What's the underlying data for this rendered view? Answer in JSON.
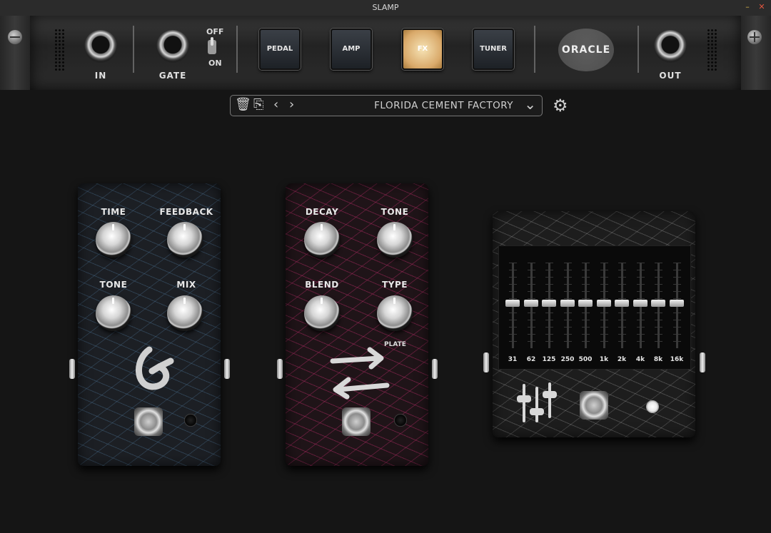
{
  "window": {
    "title": "SLAMP",
    "minimize_glyph": "–",
    "close_glyph": "✕"
  },
  "header": {
    "in_label": "IN",
    "gate_label": "GATE",
    "gate_off_label": "OFF",
    "gate_on_label": "ON",
    "nav": [
      {
        "label": "PEDAL",
        "active": false
      },
      {
        "label": "AMP",
        "active": false
      },
      {
        "label": "FX",
        "active": true
      },
      {
        "label": "TUNER",
        "active": false
      }
    ],
    "logo_text": "ORACLE",
    "out_label": "OUT"
  },
  "preset": {
    "name": "FLORIDA CEMENT FACTORY",
    "icons": [
      "trash-icon",
      "save-icon",
      "chevron-left-icon",
      "chevron-right-icon",
      "chevron-down-icon"
    ]
  },
  "settings_icon": "gear-icon",
  "delay_pedal": {
    "knobs": [
      "TIME",
      "FEEDBACK",
      "TONE",
      "MIX"
    ],
    "symbol": "delay-loop-icon",
    "accent": "#4f7aa0"
  },
  "reverb_pedal": {
    "knobs": [
      "DECAY",
      "TONE",
      "BLEND",
      "TYPE"
    ],
    "type_value": "PLATE",
    "symbol": "swap-arrows-icon",
    "accent": "#b52b66"
  },
  "eq_pedal": {
    "bands": [
      "31",
      "62",
      "125",
      "250",
      "500",
      "1k",
      "2k",
      "4k",
      "8k",
      "16k"
    ],
    "symbol": "eq-sliders-icon",
    "led_on": true
  },
  "colors": {
    "active_button": "#e9c88a",
    "background": "#151515"
  }
}
